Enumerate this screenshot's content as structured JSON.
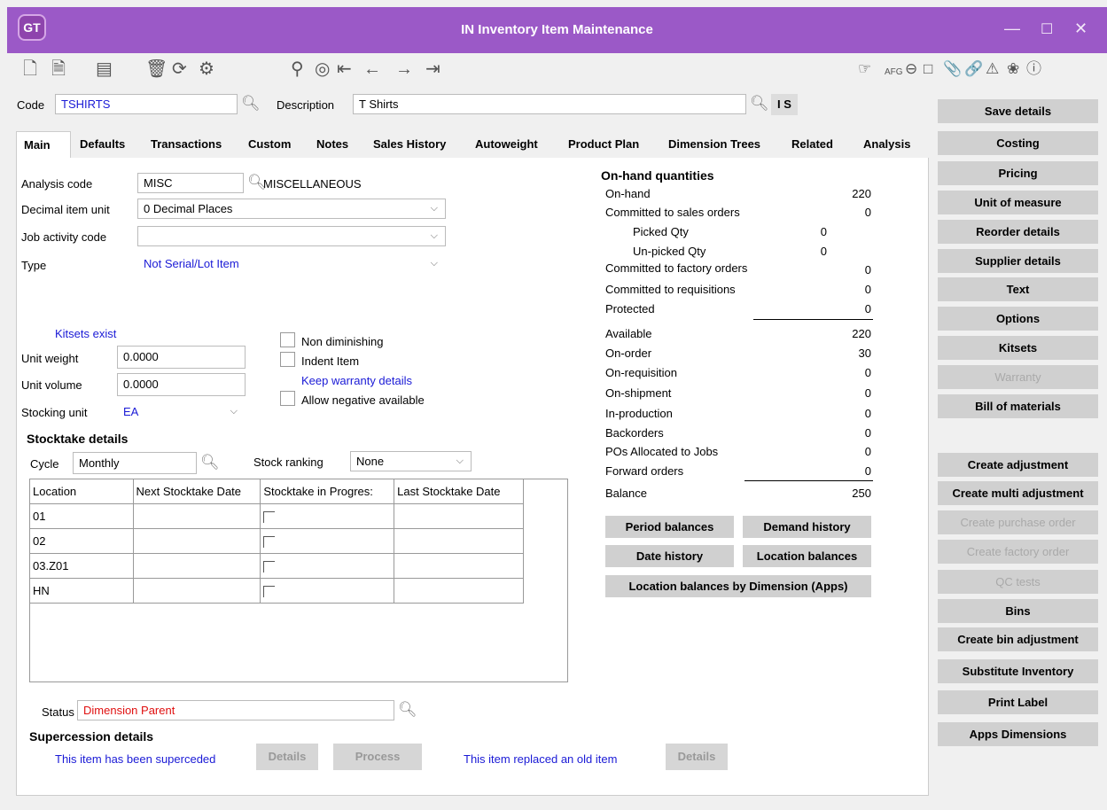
{
  "window": {
    "title": "IN Inventory Item Maintenance",
    "logo": "GT"
  },
  "header": {
    "code_label": "Code",
    "code_value": "TSHIRTS",
    "description_label": "Description",
    "description_value": "T Shirts",
    "is_badge": "I S"
  },
  "tabs": [
    "Main",
    "Defaults",
    "Transactions",
    "Custom",
    "Notes",
    "Sales History",
    "Autoweight",
    "Product Plan",
    "Dimension Trees",
    "Related",
    "Analysis"
  ],
  "main": {
    "analysis_label": "Analysis code",
    "analysis_value": "MISC",
    "analysis_desc": "MISCELLANEOUS",
    "decimal_label": "Decimal item unit",
    "decimal_value": "0 Decimal Places",
    "job_label": "Job activity code",
    "job_value": "",
    "type_label": "Type",
    "type_value": "Not Serial/Lot Item",
    "kitsets_label": "Kitsets exist",
    "unit_weight_label": "Unit weight",
    "unit_weight_value": "0.0000",
    "unit_volume_label": "Unit volume",
    "unit_volume_value": "0.0000",
    "stocking_label": "Stocking unit",
    "stocking_value": "EA",
    "non_diminishing": "Non diminishing",
    "indent_item": "Indent Item",
    "keep_warranty": "Keep warranty details",
    "allow_negative": "Allow negative available"
  },
  "stocktake": {
    "title": "Stocktake details",
    "cycle_label": "Cycle",
    "cycle_value": "Monthly",
    "ranking_label": "Stock ranking",
    "ranking_value": "None",
    "columns": [
      "Location",
      "Next Stocktake Date",
      "Stocktake in Progres:",
      "Last Stocktake Date"
    ],
    "rows": [
      {
        "location": "01",
        "next": "",
        "last": ""
      },
      {
        "location": "02",
        "next": "",
        "last": ""
      },
      {
        "location": "03.Z01",
        "next": "",
        "last": ""
      },
      {
        "location": "HN",
        "next": "",
        "last": ""
      }
    ]
  },
  "status": {
    "label": "Status",
    "value": "Dimension Parent"
  },
  "supercession": {
    "title": "Supercession details",
    "superceded_label": "This item has been superceded",
    "details1": "Details",
    "process": "Process",
    "replaced_label": "This item replaced an old item",
    "details2": "Details"
  },
  "onhand": {
    "title": "On-hand quantities",
    "rows": [
      {
        "label": "On-hand",
        "value": "220"
      },
      {
        "label": "Committed to sales orders",
        "value": "0"
      },
      {
        "label": "Picked Qty",
        "value": "0"
      },
      {
        "label": "Un-picked Qty",
        "value": "0"
      },
      {
        "label": "Committed to factory orders",
        "value": "0"
      },
      {
        "label": "Committed to requisitions",
        "value": "0"
      },
      {
        "label": "Protected",
        "value": "0"
      },
      {
        "label": "Available",
        "value": "220"
      },
      {
        "label": "On-order",
        "value": "30"
      },
      {
        "label": "On-requisition",
        "value": "0"
      },
      {
        "label": "On-shipment",
        "value": "0"
      },
      {
        "label": "In-production",
        "value": "0"
      },
      {
        "label": "Backorders",
        "value": "0"
      },
      {
        "label": "POs Allocated to Jobs",
        "value": "0"
      },
      {
        "label": "Forward orders",
        "value": "0"
      },
      {
        "label": "Balance",
        "value": "250"
      }
    ],
    "buttons": {
      "period_balances": "Period balances",
      "demand_history": "Demand history",
      "date_history": "Date history",
      "location_balances": "Location balances",
      "location_by_dimension": "Location balances by Dimension (Apps)"
    }
  },
  "right_buttons": [
    {
      "label": "Save details",
      "enabled": true
    },
    {
      "label": "Costing",
      "enabled": true
    },
    {
      "label": "Pricing",
      "enabled": true
    },
    {
      "label": "Unit of measure",
      "enabled": true
    },
    {
      "label": "Reorder details",
      "enabled": true
    },
    {
      "label": "Supplier details",
      "enabled": true
    },
    {
      "label": "Text",
      "enabled": true
    },
    {
      "label": "Options",
      "enabled": true
    },
    {
      "label": "Kitsets",
      "enabled": true
    },
    {
      "label": "Warranty",
      "enabled": false
    },
    {
      "label": "Bill of materials",
      "enabled": true
    },
    {
      "label": "Create adjustment",
      "enabled": true
    },
    {
      "label": "Create multi adjustment",
      "enabled": true
    },
    {
      "label": "Create purchase order",
      "enabled": false
    },
    {
      "label": "Create factory order",
      "enabled": false
    },
    {
      "label": "QC tests",
      "enabled": false
    },
    {
      "label": "Bins",
      "enabled": true
    },
    {
      "label": "Create bin adjustment",
      "enabled": true
    },
    {
      "label": "Substitute Inventory",
      "enabled": true
    },
    {
      "label": "Print Label",
      "enabled": true
    },
    {
      "label": "Apps Dimensions",
      "enabled": true
    }
  ],
  "toolbar_right_text": "AFG",
  "colors": {
    "titlebar": "#9b59c7",
    "accent_blue": "#1a1ad6",
    "status_red": "#e01010"
  }
}
